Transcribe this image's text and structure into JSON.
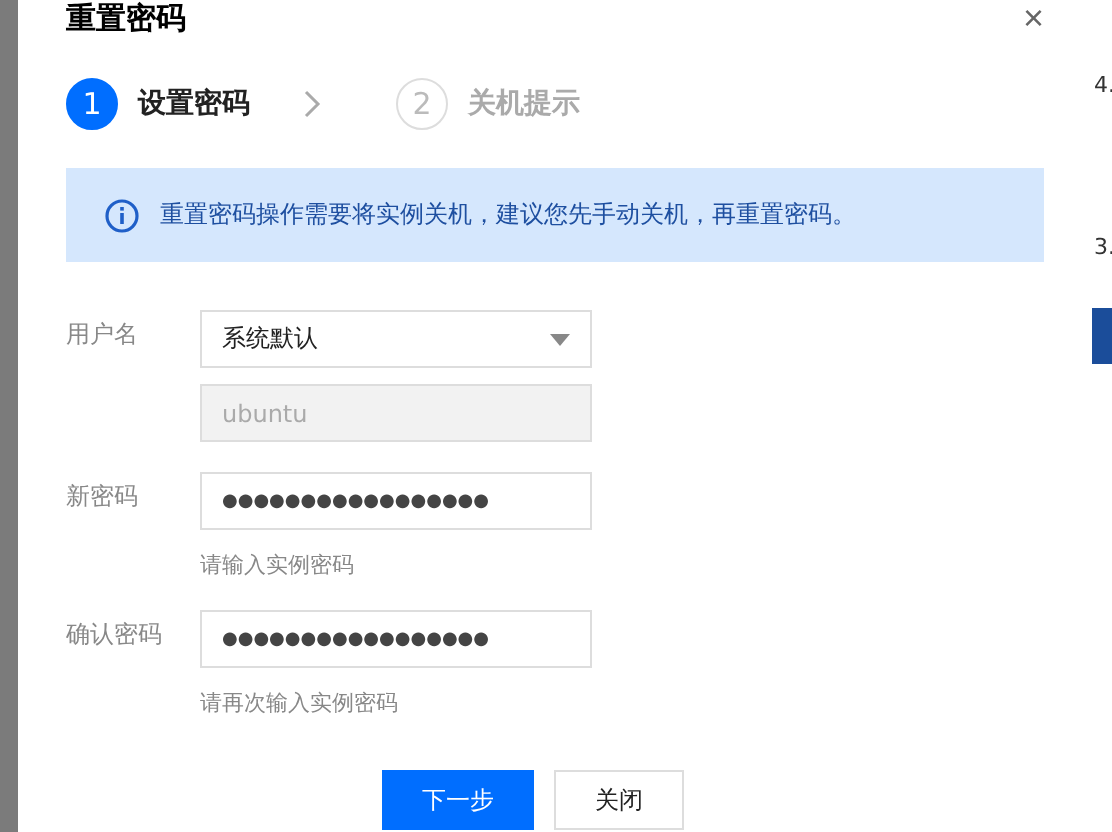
{
  "background_texts": [
    "4.",
    "3."
  ],
  "dialog": {
    "title": "重置密码",
    "close": "×"
  },
  "steps": [
    {
      "number": "1",
      "label": "设置密码",
      "selected": true
    },
    {
      "number": "2",
      "label": "关机提示",
      "selected": false
    }
  ],
  "alert": {
    "text": "重置密码操作需要将实例关机，建议您先手动关机，再重置密码。"
  },
  "fields": [
    {
      "kind": "select",
      "label": "用户名",
      "value": "系统默认"
    },
    {
      "kind": "disabled",
      "value": "ubuntu"
    },
    {
      "kind": "password",
      "label": "新密码",
      "value": "●●●●●●●●●●●●●●●●●",
      "hint": "请输入实例密码"
    },
    {
      "kind": "password",
      "label": "确认密码",
      "value": "●●●●●●●●●●●●●●●●●",
      "hint": "请再次输入实例密码"
    }
  ],
  "buttons": [
    {
      "label": "下一步",
      "kind": "primary"
    },
    {
      "label": "关闭",
      "kind": "default"
    }
  ]
}
